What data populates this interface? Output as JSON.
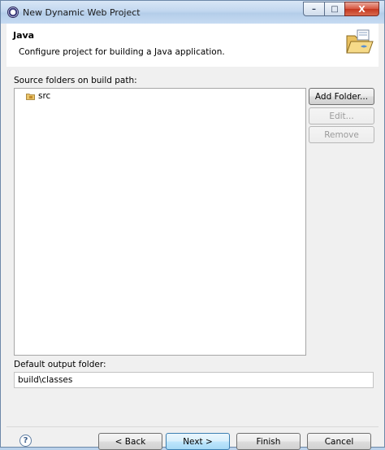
{
  "window": {
    "title": "New Dynamic Web Project",
    "controls": {
      "minimize": "–",
      "maximize": "□",
      "close": "X"
    }
  },
  "header": {
    "title": "Java",
    "description": "Configure project for building a Java application."
  },
  "source_folders": {
    "label": "Source folders on build path:",
    "items": [
      {
        "label": "src",
        "icon": "package-folder-icon"
      }
    ]
  },
  "side_buttons": {
    "add_folder": "Add Folder...",
    "edit": "Edit...",
    "remove": "Remove"
  },
  "output_folder": {
    "label": "Default output folder:",
    "value": "build\\classes"
  },
  "footer": {
    "help": "?",
    "back": "< Back",
    "next": "Next >",
    "finish": "Finish",
    "cancel": "Cancel"
  },
  "colors": {
    "title_bar": "#c2d7ef",
    "close_button": "#c4371f",
    "default_button_border": "#3c7fb1"
  }
}
